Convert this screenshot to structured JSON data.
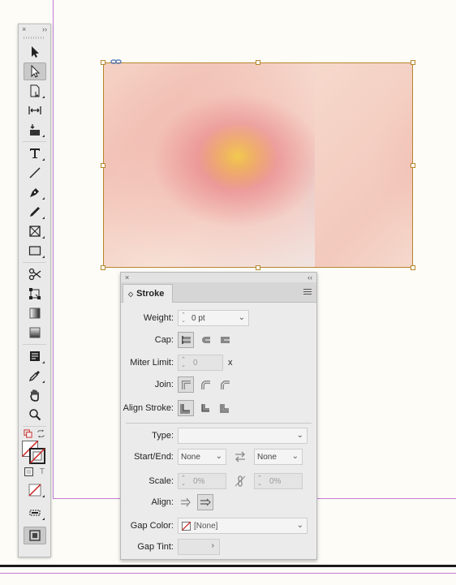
{
  "toolbox": {
    "close_glyph": "×",
    "collapse_glyph": "››",
    "tools": [
      "selection-tool",
      "direct-selection-tool",
      "page-tool",
      "gap-tool",
      "content-collector-tool",
      "type-tool",
      "line-tool",
      "pen-tool",
      "pencil-tool",
      "rectangle-frame-tool",
      "rectangle-tool",
      "scissors-tool",
      "free-transform-tool",
      "gradient-swatch-tool",
      "gradient-feather-tool",
      "note-tool",
      "eyedropper-tool",
      "hand-tool",
      "zoom-tool"
    ],
    "type_glyph": "T",
    "text_format_glyph": "T"
  },
  "stroke_panel": {
    "close_glyph": "×",
    "collapse_glyph": "‹‹",
    "tab_label": "Stroke",
    "tab_arrow": "◇",
    "weight_label": "Weight:",
    "weight_value": "0 pt",
    "cap_label": "Cap:",
    "miter_label": "Miter Limit:",
    "miter_value": "0",
    "miter_unit": "x",
    "join_label": "Join:",
    "align_stroke_label": "Align Stroke:",
    "type_label": "Type:",
    "type_value": "",
    "start_end_label": "Start/End:",
    "start_value": "None",
    "end_value": "None",
    "scale_label": "Scale:",
    "scale_start": "0%",
    "scale_end": "0%",
    "align_label": "Align:",
    "gap_color_label": "Gap Color:",
    "gap_color_value": "[None]",
    "gap_tint_label": "Gap Tint:",
    "gap_tint_arrow": "›"
  },
  "colors": {
    "frame": "#b5862c",
    "guide": "#c37bd8",
    "none_swatch": "#cc2222"
  }
}
